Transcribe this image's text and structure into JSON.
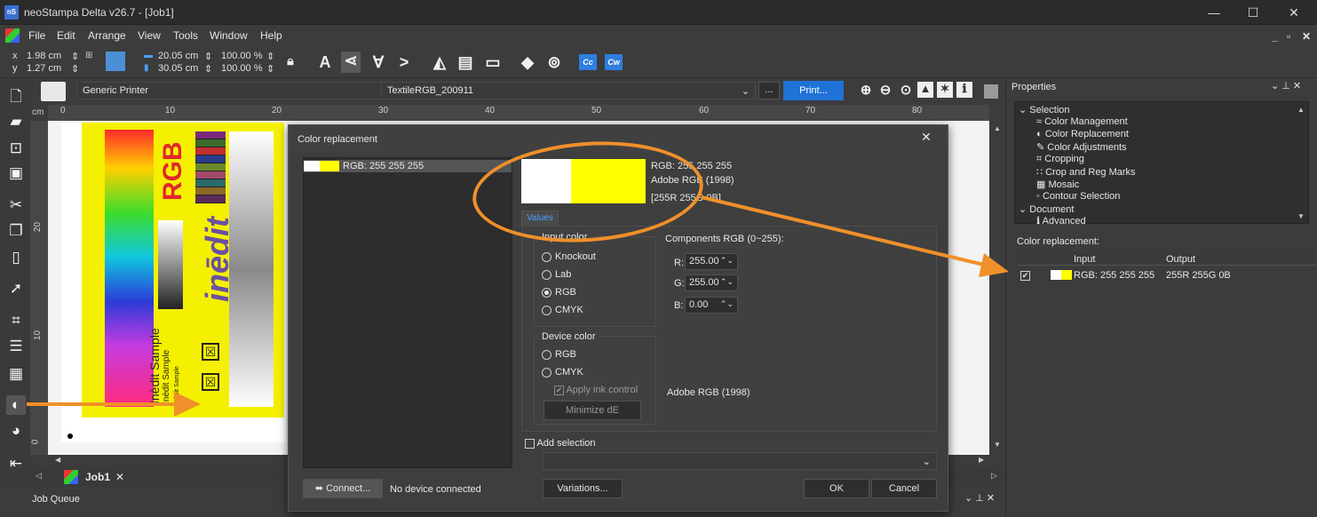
{
  "window": {
    "title": "neoStampa Delta  v26.7 - [Job1]",
    "app_icon": "nS",
    "minimize": "—",
    "maximize": "☐",
    "close": "✕"
  },
  "menu": [
    "File",
    "Edit",
    "Arrange",
    "View",
    "Tools",
    "Window",
    "Help"
  ],
  "menu_right": {
    "min": "_",
    "restore": "▫",
    "close": "✕"
  },
  "toolbar": {
    "x": "1.98 cm",
    "y": "1.27 cm",
    "x_label": "x",
    "y_label": "y",
    "width": "20.05 cm",
    "height": "30.05 cm",
    "scale_w": "100.00 %",
    "scale_h": "100.00 %",
    "cc": "Cc",
    "cw": "Cw"
  },
  "printrow": {
    "printer": "Generic Printer",
    "profile": "TextileRGB_200911",
    "more": "...",
    "print": "Print..."
  },
  "ruler": {
    "unit": "cm",
    "h_ticks": [
      "0",
      "10",
      "20",
      "30",
      "40",
      "50",
      "60",
      "70",
      "80"
    ],
    "v_ticks": [
      "20",
      "10",
      "0"
    ]
  },
  "canvas": {
    "rgb": "RGB",
    "inedit": "inēdit",
    "sample1": "Inèdit Sample",
    "sample2": "Inèdit Sample",
    "sample3": "Inèdit Sample"
  },
  "tabs": {
    "job": "Job1",
    "close": "✕"
  },
  "jobqueue": {
    "title": "Job Queue"
  },
  "properties": {
    "title": "Properties",
    "tree": [
      {
        "label": "Selection",
        "icon": "⌄"
      },
      {
        "label": "Color Management",
        "icon": "≈"
      },
      {
        "label": "Color Replacement",
        "icon": "◐"
      },
      {
        "label": "Color Adjustments",
        "icon": "✎"
      },
      {
        "label": "Cropping",
        "icon": "⌗"
      },
      {
        "label": "Crop and Reg Marks",
        "icon": "∷"
      },
      {
        "label": "Mosaic",
        "icon": "▦"
      },
      {
        "label": "Contour Selection",
        "icon": "◦"
      },
      {
        "label": "Document",
        "icon": "⌄"
      },
      {
        "label": "Advanced",
        "icon": "ℹ"
      }
    ],
    "cr_label": "Color replacement:",
    "cols": [
      "Input",
      "Output"
    ],
    "row": {
      "input": "RGB: 255 255 255",
      "output": "255R 255G 0B",
      "checked": "✔"
    }
  },
  "dialog": {
    "title": "Color replacement",
    "close": "✕",
    "list_item": "RGB: 255 255 255",
    "info": [
      "RGB: 255 255 255",
      "Adobe RGB (1998)",
      "[255R 255G 0B]"
    ],
    "tab": "Values",
    "input_color": {
      "title": "Input color",
      "options": [
        "Knockout",
        "Lab",
        "RGB",
        "CMYK"
      ],
      "selected": "RGB"
    },
    "components": {
      "title": "Components RGB (0~255):",
      "r_label": "R:",
      "g_label": "G:",
      "b_label": "B:",
      "r": "255.00",
      "g": "255.00",
      "b": "0.00"
    },
    "device_color": {
      "title": "Device color",
      "options": [
        "RGB",
        "CMYK"
      ],
      "apply": "Apply ink control",
      "minimize": "Minimize dE"
    },
    "profile": "Adobe RGB (1998)",
    "add_selection": "Add selection",
    "connect": "Connect...",
    "no_device": "No device connected",
    "variations": "Variations...",
    "ok": "OK",
    "cancel": "Cancel"
  },
  "colors": {
    "accent": "#f0902a",
    "input_swatch": "#ffffff",
    "output_swatch": "#ffff00",
    "print_button": "#1f73d6"
  }
}
